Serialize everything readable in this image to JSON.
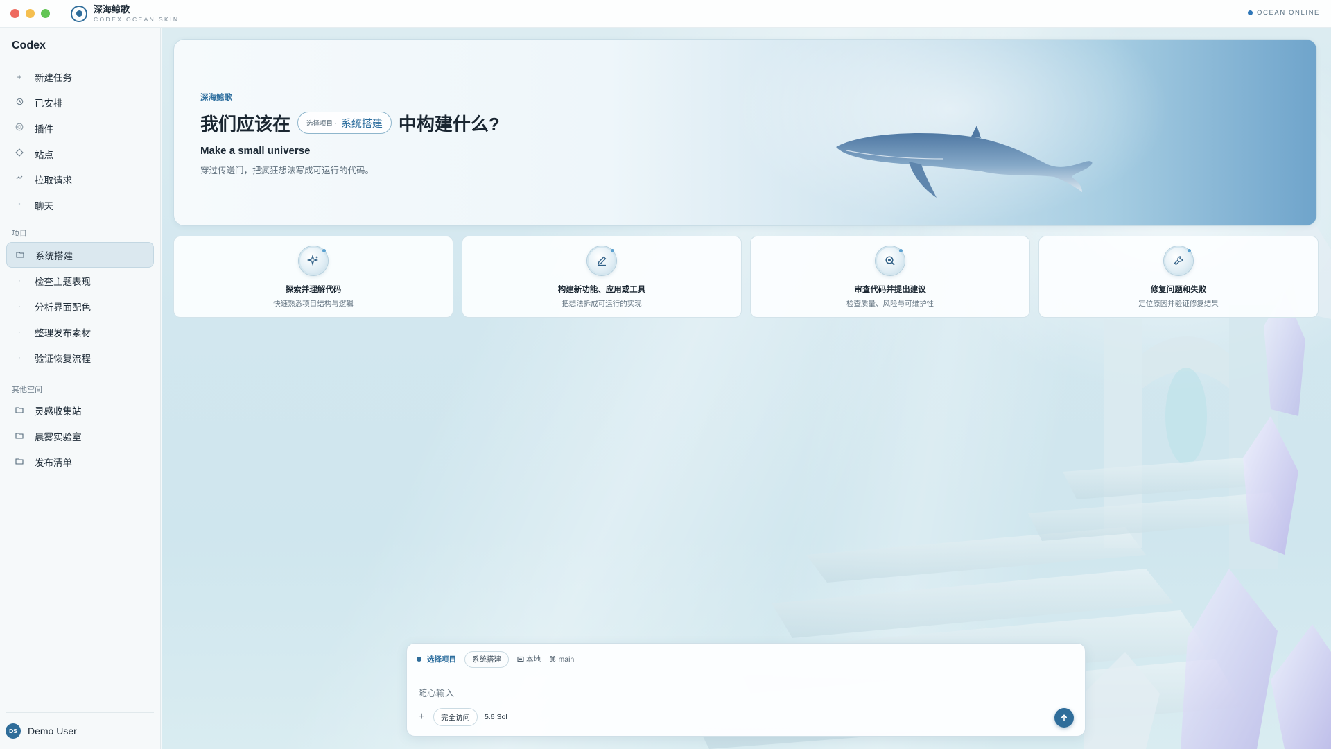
{
  "app": {
    "title": "深海鲸歌",
    "subtitle": "CODEX OCEAN SKIN",
    "status": "OCEAN ONLINE"
  },
  "sidebar": {
    "title": "Codex",
    "nav": [
      {
        "label": "新建任务",
        "icon": "plus-icon"
      },
      {
        "label": "已安排",
        "icon": "clock-icon"
      },
      {
        "label": "插件",
        "icon": "plugin-icon"
      },
      {
        "label": "站点",
        "icon": "diamond-icon"
      },
      {
        "label": "拉取请求",
        "icon": "pull-request-icon"
      },
      {
        "label": "聊天",
        "icon": "chat-icon"
      }
    ],
    "projects_label": "项目",
    "projects": [
      {
        "label": "系统搭建",
        "icon": "folder-icon",
        "active": true
      },
      {
        "label": "检查主题表现",
        "icon": "dot-icon"
      },
      {
        "label": "分析界面配色",
        "icon": "dot-icon"
      },
      {
        "label": "整理发布素材",
        "icon": "dot-icon"
      },
      {
        "label": "验证恢复流程",
        "icon": "dot-icon"
      }
    ],
    "other_label": "其他空间",
    "other": [
      {
        "label": "灵感收集站",
        "icon": "folder-icon"
      },
      {
        "label": "晨雾实验室",
        "icon": "folder-icon"
      },
      {
        "label": "发布清单",
        "icon": "folder-icon"
      }
    ],
    "user": {
      "initials": "DS",
      "name": "Demo User"
    }
  },
  "hero": {
    "kicker": "深海鲸歌",
    "title_prefix": "我们应该在",
    "project_chip_label": "选择项目 ·",
    "project_chip_value": "系统搭建",
    "title_suffix": "中构建什么?",
    "subtitle": "Make a small universe",
    "description": "穿过传送门，把疯狂想法写成可运行的代码。"
  },
  "cards": [
    {
      "title": "探索并理解代码",
      "desc": "快速熟悉项目结构与逻辑",
      "icon": "sparkle-icon"
    },
    {
      "title": "构建新功能、应用或工具",
      "desc": "把想法拆成可运行的实现",
      "icon": "pencil-icon"
    },
    {
      "title": "审查代码并提出建议",
      "desc": "检查质量、风险与可维护性",
      "icon": "search-icon"
    },
    {
      "title": "修复问题和失败",
      "desc": "定位原因并验证修复结果",
      "icon": "wrench-icon"
    }
  ],
  "composer": {
    "project_label": "选择项目",
    "project_chip": "系统搭建",
    "env": "本地",
    "branch": "main",
    "placeholder": "随心输入",
    "access": "完全访问",
    "model": "5.6 Sol"
  },
  "colors": {
    "accent": "#2f6d9a",
    "accent_text": "#2d6e9e",
    "sidebar_active": "#dbe8ef"
  }
}
